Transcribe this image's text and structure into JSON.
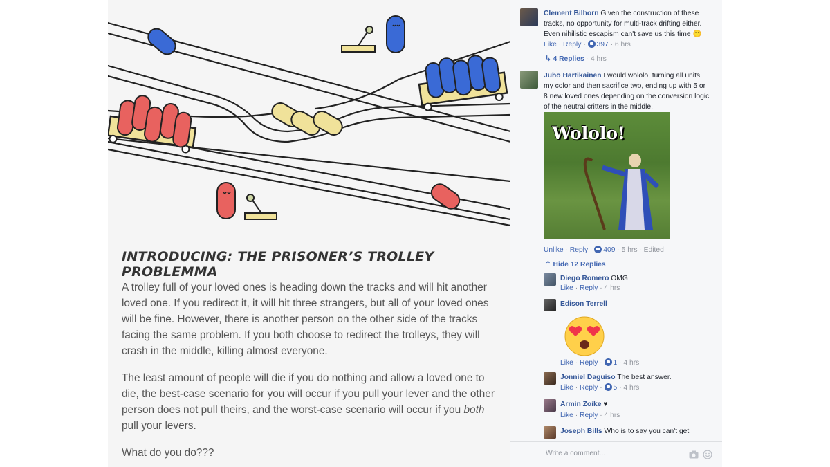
{
  "post": {
    "headline": "INTRODUCING: THE PRISONER’S TROLLEY PROBLEMMA",
    "paragraph1": "A trolley full of your loved ones is heading down the tracks and will hit another loved one. If you redirect it, it will hit three strangers, but all of your loved ones will be fine. However, there is another person on the other side of the tracks facing the same problem. If you both choose to redirect the trolleys, they will crash in the middle, killing almost everyone.",
    "paragraph2_start": "The least amount of people will die if you do nothing and allow a loved one to die, the best-case scenario for you will occur if you pull your lever and the other person does not pull theirs, and the worst-case scenario will occur if you ",
    "paragraph2_italic": "both",
    "paragraph2_end": " pull your levers.",
    "paragraph3": "What do you do???",
    "colors": {
      "red": "#e8625f",
      "blue": "#3a6ad6",
      "yellow": "#f0e29a",
      "track": "#222222"
    }
  },
  "comments": {
    "c1": {
      "author": "Clement Bilhorn",
      "text": "Given the construction of these tracks, no opportunity for multi-track drifting either. Even nihilistic escapism can't save us this time",
      "emoji": "🙁",
      "like": "Like",
      "reply": "Reply",
      "likes": "397",
      "time": "6 hrs",
      "replies_label": "4 Replies",
      "replies_time": "4 hrs"
    },
    "c2": {
      "author": "Juho Hartikainen",
      "text": "I would wololo, turning all units my color and then sacrifice two, ending up with 5 or 8 new loved ones depending on the conversion logic of the neutral critters in the middle.",
      "image_caption": "Wololo!",
      "unlike": "Unlike",
      "reply": "Reply",
      "likes": "409",
      "time": "5 hrs",
      "edited": "Edited",
      "hide_replies": "Hide 12 Replies"
    },
    "r1": {
      "author": "Diego Romero",
      "text": "OMG",
      "like": "Like",
      "reply": "Reply",
      "time": "4 hrs"
    },
    "r2": {
      "author": "Edison Terrell",
      "sticker": "heart-eyes-emoji",
      "like": "Like",
      "reply": "Reply",
      "likes": "1",
      "time": "4 hrs"
    },
    "r3": {
      "author": "Jonniel Daguiso",
      "text": "The best answer.",
      "like": "Like",
      "reply": "Reply",
      "likes": "5",
      "time": "4 hrs"
    },
    "r4": {
      "author": "Armin Zoike",
      "text": "♥",
      "like": "Like",
      "reply": "Reply",
      "time": "4 hrs"
    },
    "r5": {
      "author": "Joseph Bills",
      "text": "Who is to say you can't get"
    },
    "write_placeholder": "Write a comment..."
  }
}
